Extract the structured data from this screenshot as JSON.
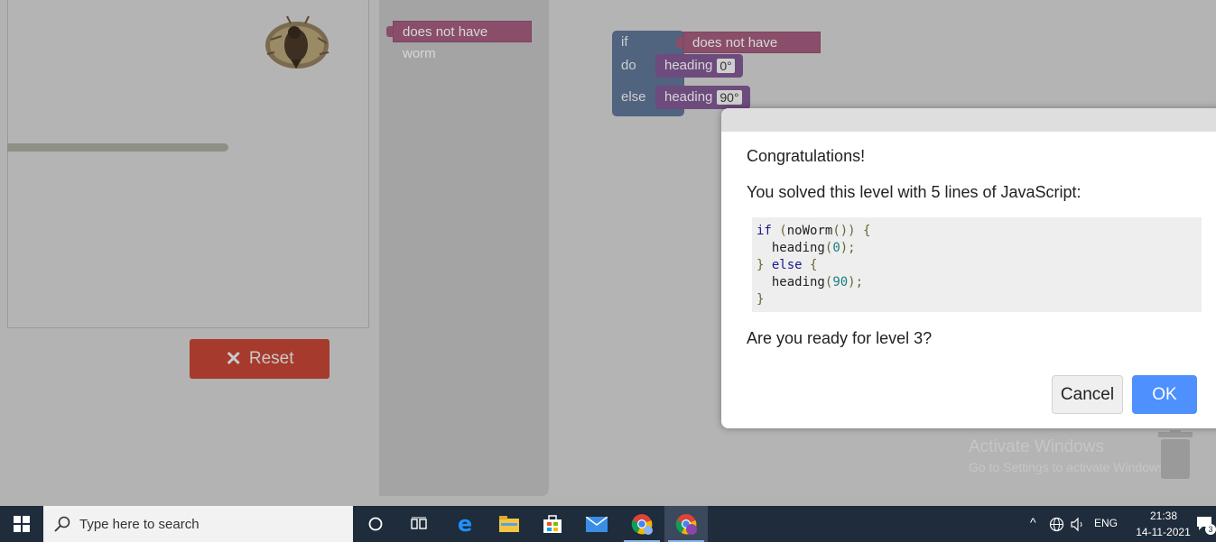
{
  "toolbox": {
    "condition_block": "does not have worm"
  },
  "workspace": {
    "if_label": "if",
    "do_label": "do",
    "else_label": "else",
    "condition_block": "does not have worm",
    "do_block": {
      "label": "heading",
      "value": "0°"
    },
    "else_block": {
      "label": "heading",
      "value": "90°"
    }
  },
  "game": {
    "reset_label": "Reset"
  },
  "dialog": {
    "title": "Congratulations!",
    "message": "You solved this level with 5 lines of JavaScript:",
    "code_lines": [
      "if (noWorm()) {",
      "  heading(0);",
      "} else {",
      "  heading(90);",
      "}"
    ],
    "question": "Are you ready for level 3?",
    "cancel_label": "Cancel",
    "ok_label": "OK"
  },
  "watermark": {
    "line1": "Activate Windows",
    "line2": "Go to Settings to activate Windows."
  },
  "taskbar": {
    "search_placeholder": "Type here to search",
    "language": "ENG",
    "time": "21:38",
    "date": "14-11-2021",
    "notification_count": "3"
  },
  "colors": {
    "accent": "#4d90fe",
    "reset": "#a63a2c",
    "logic_block": "#50637f",
    "sensor_block": "#8a4e6a",
    "movement_block": "#6e4b7d"
  }
}
